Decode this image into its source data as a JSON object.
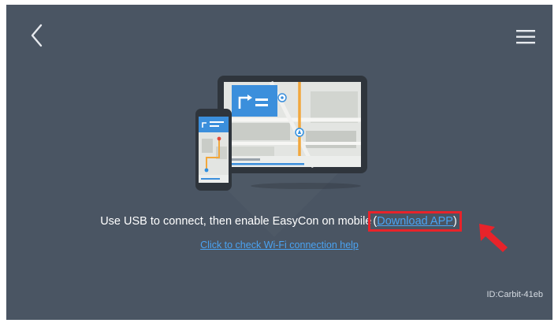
{
  "header": {
    "back_icon": "chevron-left-icon",
    "menu_icon": "hamburger-menu-icon"
  },
  "main": {
    "illustration": "tablet-and-phone-navigation-illustration",
    "instruction_text": "Use USB to connect, then enable EasyCon on mobile",
    "open_paren": "(",
    "download_link": "Download APP",
    "close_paren": ")",
    "wifi_help_link": "Click to check Wi-Fi connection help"
  },
  "annotation": {
    "highlight_color": "#e8232a",
    "arrow_icon": "red-pointer-arrow-icon"
  },
  "footer": {
    "device_id": "ID:Carbit-41eb"
  },
  "colors": {
    "background": "#4a5563",
    "link": "#4aa3f2",
    "text": "#ffffff"
  }
}
